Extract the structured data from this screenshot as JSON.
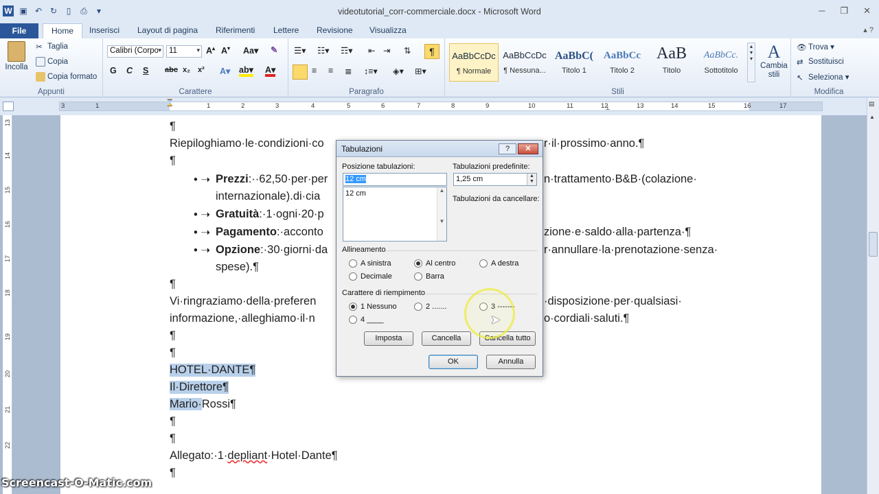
{
  "window": {
    "title": "videotutorial_corr-commerciale.docx - Microsoft Word"
  },
  "tabs": [
    "File",
    "Home",
    "Inserisci",
    "Layout di pagina",
    "Riferimenti",
    "Lettere",
    "Revisione",
    "Visualizza"
  ],
  "ribbon": {
    "appunti": {
      "label": "Appunti",
      "incolla": "Incolla",
      "taglia": "Taglia",
      "copia": "Copia",
      "copia_formato": "Copia formato"
    },
    "carattere": {
      "label": "Carattere",
      "font": "Calibri (Corpo",
      "size": "11"
    },
    "paragrafo": {
      "label": "Paragrafo"
    },
    "stili": {
      "label": "Stili",
      "items": [
        {
          "sample": "AaBbCcDc",
          "name": "¶ Normale"
        },
        {
          "sample": "AaBbCcDc",
          "name": "¶ Nessuna..."
        },
        {
          "sample": "AaBbC(",
          "name": "Titolo 1"
        },
        {
          "sample": "AaBbCc",
          "name": "Titolo 2"
        },
        {
          "sample": "AaB",
          "name": "Titolo"
        },
        {
          "sample": "AaBbCc.",
          "name": "Sottotitolo"
        }
      ],
      "cambia": "Cambia stili"
    },
    "modifica": {
      "label": "Modifica",
      "trova": "Trova",
      "sostituisci": "Sostituisci",
      "seleziona": "Seleziona"
    }
  },
  "ruler_numbers": [
    "3",
    "1",
    "1",
    "2",
    "3",
    "4",
    "5",
    "6",
    "7",
    "8",
    "9",
    "10",
    "11",
    "12",
    "13",
    "14",
    "15",
    "16",
    "17"
  ],
  "vruler_numbers": [
    "13",
    "14",
    "15",
    "16",
    "17",
    "18",
    "19",
    "20",
    "21",
    "22"
  ],
  "document": {
    "lines": [
      "¶",
      "Riepiloghiamo·le·condizioni·co",
      "r·il·prossimo·anno.¶",
      "¶",
      "Vi·ringraziamo·della·preferen",
      "·disposizione·per·qualsiasi·",
      "informazione,·alleghiamo·il·n",
      "o·cordiali·saluti.¶",
      "¶",
      "¶",
      "¶",
      "¶"
    ],
    "bullets": [
      {
        "bold": "Prezzi",
        "rest": ":··62,50·per·per",
        "right": "n·trattamento·B&B·(colazione·",
        "cont": "internazionale).di·cia"
      },
      {
        "bold": "Gratuità",
        "rest": ":·1·ogni·20·p",
        "right": ""
      },
      {
        "bold": "Pagamento",
        "rest": ":·acconto",
        "right": "zione·e·saldo·alla·partenza·¶"
      },
      {
        "bold": "Opzione",
        "rest": ":·30·giorni·da",
        "right": "r·annullare·la·prenotazione·senza·",
        "cont": "spese).¶"
      }
    ],
    "signature": [
      "HOTEL·DANTE¶",
      "Il·Direttore¶",
      "Mario·",
      "Rossi¶"
    ],
    "allegato_pre": "Allegato:·1·",
    "allegato_word": "depliant",
    "allegato_post": "·Hotel·Dante¶"
  },
  "dialog": {
    "title": "Tabulazioni",
    "help": "?",
    "close": "✕",
    "pos_label": "Posizione tabulazioni:",
    "pos_value": "12 cm",
    "pos_list": [
      "12 cm"
    ],
    "default_label": "Tabulazioni predefinite:",
    "default_value": "1,25 cm",
    "to_clear_label": "Tabulazioni da cancellare:",
    "align_label": "Allineamento",
    "align_options": [
      {
        "label": "A sinistra",
        "checked": false
      },
      {
        "label": "Al centro",
        "checked": true
      },
      {
        "label": "A destra",
        "checked": false
      },
      {
        "label": "Decimale",
        "checked": false
      },
      {
        "label": "Barra",
        "checked": false
      }
    ],
    "leader_label": "Carattere di riempimento",
    "leader_options": [
      {
        "label": "1 Nessuno",
        "checked": true
      },
      {
        "label": "2 .......",
        "checked": false
      },
      {
        "label": "3 -------",
        "checked": false
      },
      {
        "label": "4 ____",
        "checked": false
      }
    ],
    "btn_imposta": "Imposta",
    "btn_cancella": "Cancella",
    "btn_cancella_tutto": "Cancella tutto",
    "btn_ok": "OK",
    "btn_annulla": "Annulla"
  },
  "watermark": "Screencast-O-Matic.com"
}
